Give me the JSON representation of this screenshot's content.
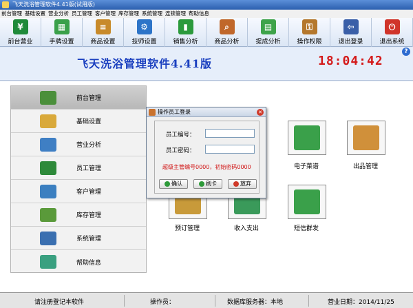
{
  "window": {
    "title": "飞天洗浴管理软件4.41版(试用版)"
  },
  "menu": [
    "前台管理",
    "基础设置",
    "营业分析",
    "员工管理",
    "客户管理",
    "库存管理",
    "系统管理",
    "连锁管理",
    "帮助信息"
  ],
  "toolbar": [
    {
      "label": "前台营业",
      "icon": "reception-icon",
      "color": "#1f8a3a"
    },
    {
      "label": "手牌设置",
      "icon": "grid-icon",
      "color": "#3aa04a"
    },
    {
      "label": "商品设置",
      "icon": "books-icon",
      "color": "#c88a2a"
    },
    {
      "label": "技师设置",
      "icon": "gear-icon",
      "color": "#2d74c8"
    },
    {
      "label": "销售分析",
      "icon": "chart-icon",
      "color": "#2b9a3c"
    },
    {
      "label": "商品分析",
      "icon": "magnifier-icon",
      "color": "#c0672a"
    },
    {
      "label": "提成分析",
      "icon": "spreadsheet-icon",
      "color": "#3ea34a"
    },
    {
      "label": "操作权限",
      "icon": "lock-icon",
      "color": "#b4772c"
    },
    {
      "label": "退出登录",
      "icon": "logout-icon",
      "color": "#3a5fa8"
    },
    {
      "label": "退出系统",
      "icon": "power-icon",
      "color": "#d0342a"
    }
  ],
  "banner": {
    "title": "飞天洗浴管理软件4.41版",
    "clock": "18:04:42",
    "help": "?"
  },
  "sidebar": [
    {
      "label": "前台管理",
      "icon": "reception-icon",
      "color": "#4b8f3b",
      "active": true
    },
    {
      "label": "基础设置",
      "icon": "settings-icon",
      "color": "#d9a93a",
      "active": false
    },
    {
      "label": "营业分析",
      "icon": "analysis-icon",
      "color": "#3f7fc4",
      "active": false
    },
    {
      "label": "员工管理",
      "icon": "staff-icon",
      "color": "#2e8a3a",
      "active": false
    },
    {
      "label": "客户管理",
      "icon": "customer-icon",
      "color": "#3b7fc0",
      "active": false
    },
    {
      "label": "库存管理",
      "icon": "warehouse-icon",
      "color": "#5a9a3a",
      "active": false
    },
    {
      "label": "系统管理",
      "icon": "system-icon",
      "color": "#3a6fb0",
      "active": false
    },
    {
      "label": "帮助信息",
      "icon": "help-books-icon",
      "color": "#3aa080",
      "active": false
    }
  ],
  "tiles": [
    {
      "label": "电子菜谱",
      "icon": "menu-book-icon",
      "color": "#3aa04a"
    },
    {
      "label": "出品管理",
      "icon": "boxes-icon",
      "color": "#d0903a"
    },
    {
      "label": "预订管理",
      "icon": "reservation-icon",
      "color": "#c89a3a"
    },
    {
      "label": "收入支出",
      "icon": "money-icon",
      "color": "#3a9a5a"
    },
    {
      "label": "短信群发",
      "icon": "sms-icon",
      "color": "#3aa04a"
    }
  ],
  "dialog": {
    "title": "操作员工登录",
    "emp_no_label": "员工编号：",
    "emp_no_value": "",
    "password_label": "员工密码：",
    "password_value": "",
    "hint": "超级主管编号0000，初始密码0000",
    "ok": "确认",
    "card": "刷卡",
    "cancel": "放弃"
  },
  "status": {
    "register": "请注册登记本软件",
    "operator": "操作员：",
    "db_server": "数据库服务器：本地",
    "business_date": "营业日期：2014/11/25"
  }
}
